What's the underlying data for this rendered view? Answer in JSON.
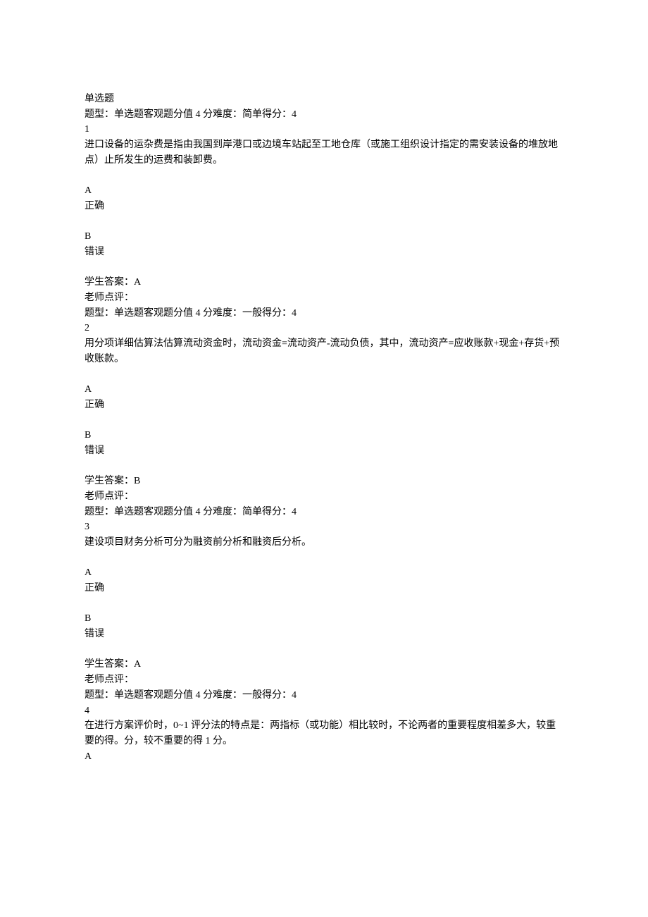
{
  "sectionTitle": "单选题",
  "questions": [
    {
      "meta": "题型：单选题客观题分值 4 分难度：简单得分：4",
      "number": "1",
      "promptLines": [
        "进口设备的运杂费是指由我国到岸港口或边境车站起至工地仓库（或施工组织设计指定的需安装设备的堆放地点）止所发生的运费和装卸费。"
      ],
      "options": [
        {
          "letter": "A",
          "text": "正确"
        },
        {
          "letter": "B",
          "text": "错误"
        }
      ],
      "answerLabel": "学生答案：",
      "answerValue": "A",
      "commentLabel": "老师点评：",
      "commentValue": ""
    },
    {
      "meta": "题型：单选题客观题分值 4 分难度：一般得分：4",
      "number": "2",
      "promptLines": [
        "用分项详细估算法估算流动资金时，流动资金=流动资产-流动负债，其中，流动资产=应收账款+现金+存货+预收账款。"
      ],
      "options": [
        {
          "letter": "A",
          "text": "正确"
        },
        {
          "letter": "B",
          "text": "错误"
        }
      ],
      "answerLabel": "学生答案：",
      "answerValue": "B",
      "commentLabel": "老师点评：",
      "commentValue": ""
    },
    {
      "meta": "题型：单选题客观题分值 4 分难度：简单得分：4",
      "number": "3",
      "promptLines": [
        "建设项目财务分析可分为融资前分析和融资后分析。"
      ],
      "options": [
        {
          "letter": "A",
          "text": "正确"
        },
        {
          "letter": "B",
          "text": "错误"
        }
      ],
      "answerLabel": "学生答案：",
      "answerValue": "A",
      "commentLabel": "老师点评：",
      "commentValue": ""
    },
    {
      "meta": "题型：单选题客观题分值 4 分难度：一般得分：4",
      "number": "4",
      "promptLines": [
        "在进行方案评价时，0~1 评分法的特点是：两指标（或功能）相比较时，不论两者的重要程度相差多大，较重要的得。分，较不重要的得 1 分。"
      ],
      "options": [
        {
          "letter": "A",
          "text": ""
        }
      ],
      "answerLabel": "",
      "answerValue": "",
      "commentLabel": "",
      "commentValue": ""
    }
  ]
}
